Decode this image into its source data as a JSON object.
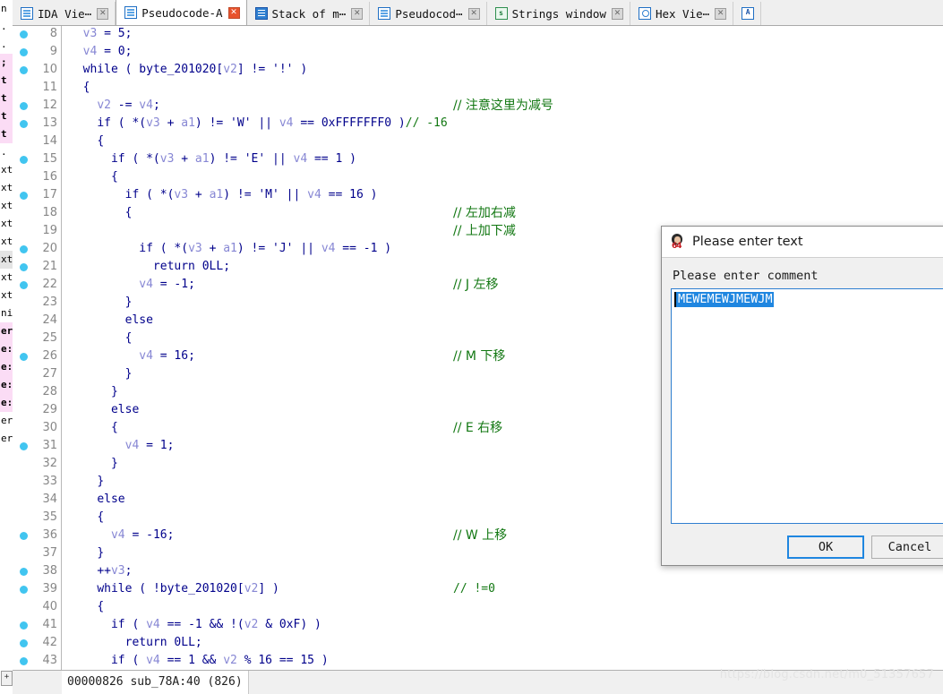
{
  "tabs": [
    {
      "label": "IDA Vie⋯",
      "icon": "document-icon",
      "active": false,
      "close": "✕"
    },
    {
      "label": "Pseudocode-A",
      "icon": "document-icon",
      "active": true,
      "close": "✕"
    },
    {
      "label": "Stack of m⋯",
      "icon": "document-blue-icon",
      "active": false,
      "close": "✕"
    },
    {
      "label": "Pseudocod⋯",
      "icon": "document-icon",
      "active": false,
      "close": "✕"
    },
    {
      "label": "Strings window",
      "icon": "strings-icon",
      "active": false,
      "close": "✕"
    },
    {
      "label": "Hex Vie⋯",
      "icon": "hex-icon",
      "active": false,
      "close": "✕"
    },
    {
      "label": "",
      "icon": "az-icon",
      "active": false,
      "close": ""
    }
  ],
  "code": {
    "lines": [
      {
        "num": 8,
        "dot": true,
        "indent": 2,
        "text": "v3 = 5;",
        "comment": "",
        "comment_cjk": false
      },
      {
        "num": 9,
        "dot": true,
        "indent": 2,
        "text": "v4 = 0;",
        "comment": "",
        "comment_cjk": false
      },
      {
        "num": 10,
        "dot": true,
        "indent": 2,
        "text": "while ( byte_201020[v2] != '!' )",
        "comment": "",
        "comment_cjk": false
      },
      {
        "num": 11,
        "dot": false,
        "indent": 2,
        "text": "{",
        "comment": "",
        "comment_cjk": false
      },
      {
        "num": 12,
        "dot": true,
        "indent": 4,
        "text": "v2 -= v4;",
        "comment": "// 注意这里为减号",
        "comment_cjk": true
      },
      {
        "num": 13,
        "dot": true,
        "indent": 4,
        "text": "if ( *(v3 + a1) != 'W' || v4 == 0xFFFFFFF0 )",
        "comment": "// -16",
        "comment_cjk": false,
        "comment_inline": true
      },
      {
        "num": 14,
        "dot": false,
        "indent": 4,
        "text": "{",
        "comment": "",
        "comment_cjk": false
      },
      {
        "num": 15,
        "dot": true,
        "indent": 6,
        "text": "if ( *(v3 + a1) != 'E' || v4 == 1 )",
        "comment": "",
        "comment_cjk": false
      },
      {
        "num": 16,
        "dot": false,
        "indent": 6,
        "text": "{",
        "comment": "",
        "comment_cjk": false
      },
      {
        "num": 17,
        "dot": true,
        "indent": 8,
        "text": "if ( *(v3 + a1) != 'M' || v4 == 16 )",
        "comment": "",
        "comment_cjk": false
      },
      {
        "num": 18,
        "dot": false,
        "indent": 8,
        "text": "{",
        "comment": "// 左加右减",
        "comment_cjk": true
      },
      {
        "num": 19,
        "dot": false,
        "indent": 8,
        "text": "",
        "comment": "// 上加下减",
        "comment_cjk": true
      },
      {
        "num": 20,
        "dot": true,
        "indent": 10,
        "text": "if ( *(v3 + a1) != 'J' || v4 == -1 )",
        "comment": "",
        "comment_cjk": false
      },
      {
        "num": 21,
        "dot": true,
        "indent": 12,
        "text": "return 0LL;",
        "comment": "",
        "comment_cjk": false
      },
      {
        "num": 22,
        "dot": true,
        "indent": 10,
        "text": "v4 = -1;",
        "comment": "// J 左移",
        "comment_cjk": true
      },
      {
        "num": 23,
        "dot": false,
        "indent": 8,
        "text": "}",
        "comment": "",
        "comment_cjk": false
      },
      {
        "num": 24,
        "dot": false,
        "indent": 8,
        "text": "else",
        "comment": "",
        "comment_cjk": false
      },
      {
        "num": 25,
        "dot": false,
        "indent": 8,
        "text": "{",
        "comment": "",
        "comment_cjk": false
      },
      {
        "num": 26,
        "dot": true,
        "indent": 10,
        "text": "v4 = 16;",
        "comment": "// M 下移",
        "comment_cjk": true
      },
      {
        "num": 27,
        "dot": false,
        "indent": 8,
        "text": "}",
        "comment": "",
        "comment_cjk": false
      },
      {
        "num": 28,
        "dot": false,
        "indent": 6,
        "text": "}",
        "comment": "",
        "comment_cjk": false
      },
      {
        "num": 29,
        "dot": false,
        "indent": 6,
        "text": "else",
        "comment": "",
        "comment_cjk": false
      },
      {
        "num": 30,
        "dot": false,
        "indent": 6,
        "text": "{",
        "comment": "// E 右移",
        "comment_cjk": true
      },
      {
        "num": 31,
        "dot": true,
        "indent": 8,
        "text": "v4 = 1;",
        "comment": "",
        "comment_cjk": false
      },
      {
        "num": 32,
        "dot": false,
        "indent": 6,
        "text": "}",
        "comment": "",
        "comment_cjk": false
      },
      {
        "num": 33,
        "dot": false,
        "indent": 4,
        "text": "}",
        "comment": "",
        "comment_cjk": false
      },
      {
        "num": 34,
        "dot": false,
        "indent": 4,
        "text": "else",
        "comment": "",
        "comment_cjk": false
      },
      {
        "num": 35,
        "dot": false,
        "indent": 4,
        "text": "{",
        "comment": "",
        "comment_cjk": false
      },
      {
        "num": 36,
        "dot": true,
        "indent": 6,
        "text": "v4 = -16;",
        "comment": "// W 上移",
        "comment_cjk": true
      },
      {
        "num": 37,
        "dot": false,
        "indent": 4,
        "text": "}",
        "comment": "",
        "comment_cjk": false
      },
      {
        "num": 38,
        "dot": true,
        "indent": 4,
        "text": "++v3;",
        "comment": "",
        "comment_cjk": false
      },
      {
        "num": 39,
        "dot": true,
        "indent": 4,
        "text": "while ( !byte_201020[v2] )",
        "comment": "// !=0",
        "comment_cjk": false
      },
      {
        "num": 40,
        "dot": false,
        "indent": 4,
        "text": "{",
        "comment": "",
        "comment_cjk": false
      },
      {
        "num": 41,
        "dot": true,
        "indent": 6,
        "text": "if ( v4 == -1 && !(v2 & 0xF) )",
        "comment": "",
        "comment_cjk": false
      },
      {
        "num": 42,
        "dot": true,
        "indent": 8,
        "text": "return 0LL;",
        "comment": "",
        "comment_cjk": false
      },
      {
        "num": 43,
        "dot": true,
        "indent": 6,
        "text": "if ( v4 == 1 && v2 % 16 == 15 )",
        "comment": "",
        "comment_cjk": false
      }
    ],
    "colors": {
      "variable": "#8787d4",
      "keyword": "#00008b",
      "comment": "#117711",
      "line_number": "#878787",
      "breakpoint_dot": "#41c5f0",
      "background": "#ffffff"
    }
  },
  "status_bar": {
    "address": "00000826",
    "location": "sub_78A:40 (826)"
  },
  "watermark": {
    "text": "https://blog.csdn.net/m0_51357657"
  },
  "dialog": {
    "title": "Please enter text",
    "icon": "ida-64-icon",
    "label": "Please enter comment",
    "input_value": "MEWEMEWJMEWJM",
    "ok_label": "OK",
    "cancel_label": "Cancel",
    "focus_color": "#1f86e0",
    "selection_color": "#1f86e0"
  },
  "left_sliver": {
    "rows": [
      {
        "text": "n",
        "style": "plain"
      },
      {
        "text": ". t",
        "style": "plain"
      },
      {
        "text": ".",
        "style": "plain"
      },
      {
        "text": ";",
        "style": "pink"
      },
      {
        "text": "t",
        "style": "pink"
      },
      {
        "text": "t",
        "style": "pink"
      },
      {
        "text": "t",
        "style": "pink"
      },
      {
        "text": "t",
        "style": "pink"
      },
      {
        "text": ".",
        "style": "plain"
      },
      {
        "text": "xt",
        "style": "plain"
      },
      {
        "text": "xt",
        "style": "plain"
      },
      {
        "text": "xt",
        "style": "plain"
      },
      {
        "text": "xt",
        "style": "plain"
      },
      {
        "text": "xt",
        "style": "plain"
      },
      {
        "text": "xt",
        "style": "gray"
      },
      {
        "text": "xt",
        "style": "plain"
      },
      {
        "text": "xt",
        "style": "plain"
      },
      {
        "text": "ni",
        "style": "plain"
      },
      {
        "text": "er",
        "style": "pink"
      },
      {
        "text": "e:",
        "style": "pink"
      },
      {
        "text": "e:",
        "style": "pink"
      },
      {
        "text": "e:",
        "style": "pink"
      },
      {
        "text": "e:",
        "style": "pink"
      },
      {
        "text": "er",
        "style": "plain"
      },
      {
        "text": "er",
        "style": "plain"
      }
    ],
    "button": "+"
  }
}
